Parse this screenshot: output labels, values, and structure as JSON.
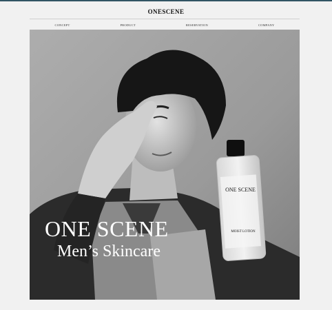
{
  "header": {
    "brand": "ONESCENE"
  },
  "nav": {
    "items": [
      "CONCEPT",
      "PRODUCT",
      "RESERVATION",
      "COMPANY"
    ]
  },
  "hero": {
    "title": "ONE SCENE",
    "subtitle": "Men’s Skincare",
    "bottle_brand": "ONE SCENE",
    "bottle_product": "MOIST LOTION"
  },
  "colors": {
    "top_bar": "#315463",
    "page_background": "#f1f1f1",
    "hero_background": "#9c9c9c"
  }
}
